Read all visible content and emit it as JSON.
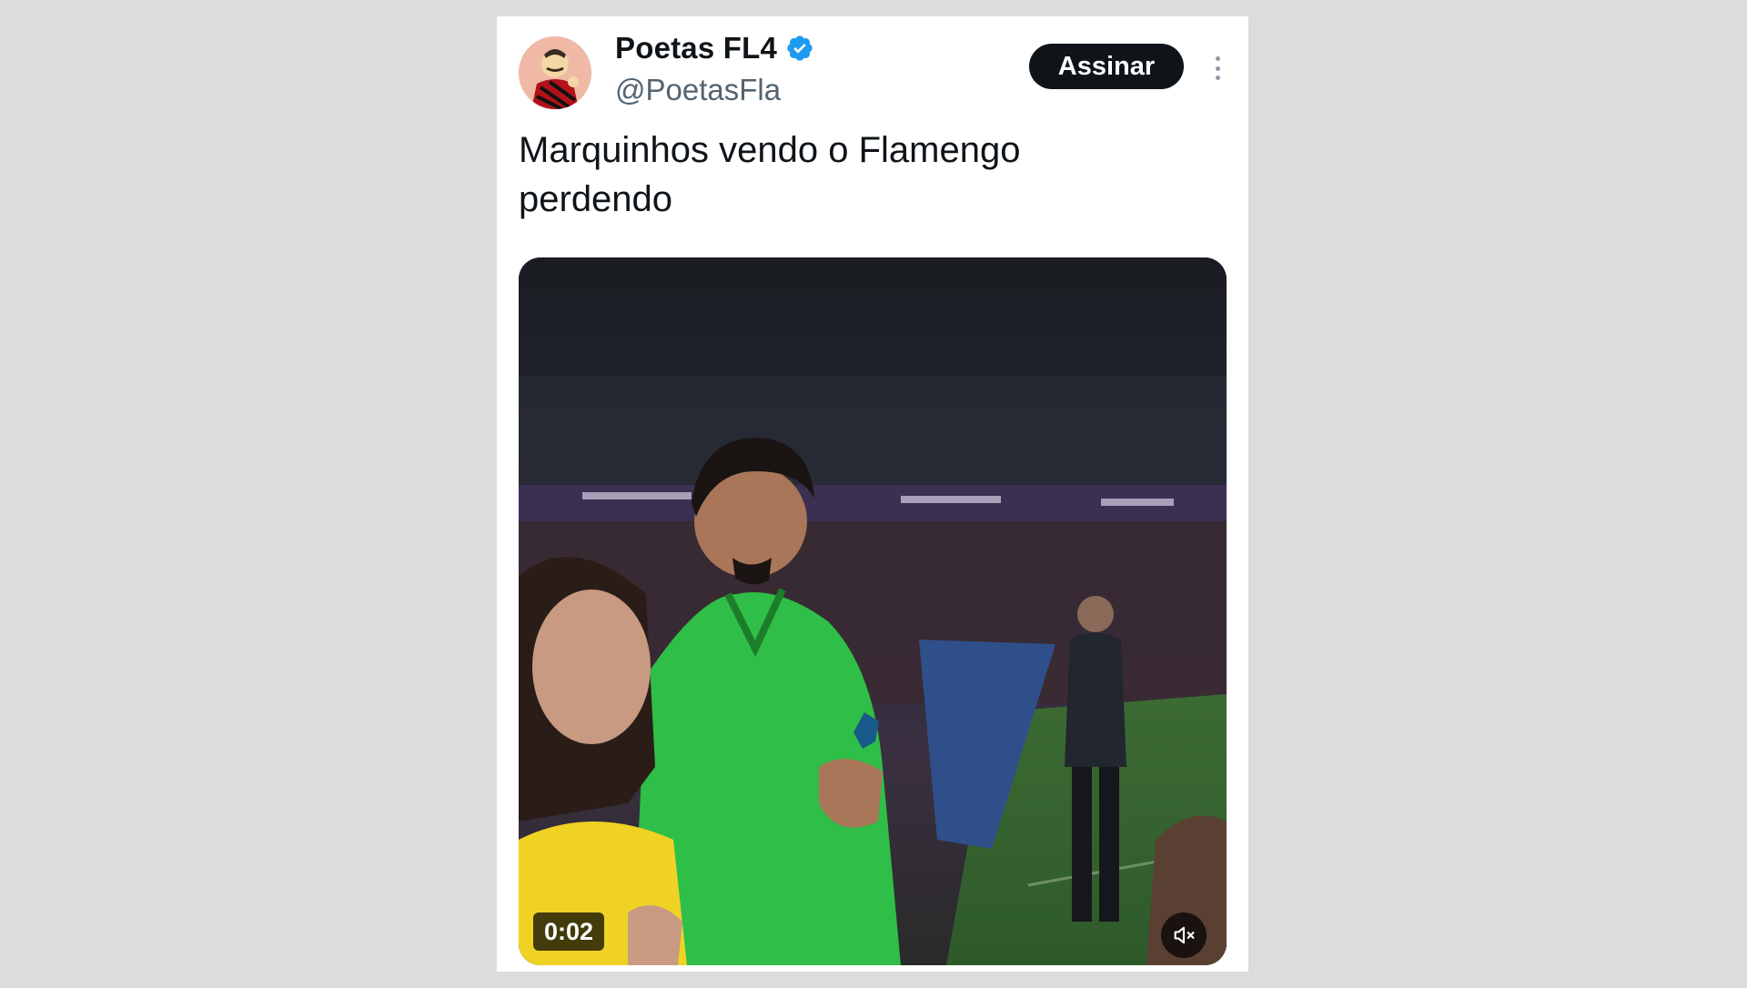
{
  "tweet": {
    "author": {
      "display_name": "Poetas FL4",
      "handle": "@PoetasFla",
      "verified_icon": "verified-badge-icon",
      "avatar": "cartoon-avatar"
    },
    "subscribe_label": "Assinar",
    "more_icon": "more-vertical-icon",
    "text_line1": "Marquinhos vendo o Flamengo",
    "text_line2": "perdendo",
    "media": {
      "type": "video",
      "timestamp": "0:02",
      "mute_icon": "speaker-muted-icon"
    }
  },
  "colors": {
    "page_background": "#dcdcdc",
    "card_background": "#ffffff",
    "text_primary": "#0f1419",
    "text_secondary": "#536471",
    "verified_blue": "#1d9bf0",
    "button_background": "#0f1419"
  }
}
